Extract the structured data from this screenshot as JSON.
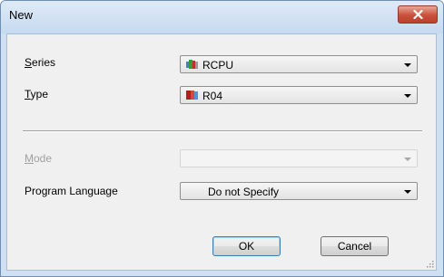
{
  "window": {
    "title": "New"
  },
  "form": {
    "series": {
      "label": "Series",
      "accel": "S",
      "rest": "eries",
      "value": "RCPU",
      "icon": "rcpu-series-icon"
    },
    "type": {
      "label": "Type",
      "accel": "T",
      "rest": "ype",
      "value": "R04",
      "icon": "r04-cpu-icon"
    },
    "mode": {
      "label": "Mode",
      "accel": "M",
      "rest": "ode",
      "value": "",
      "enabled": false
    },
    "language": {
      "label": "Program Language",
      "pre": "Pro",
      "accel": "g",
      "rest": "ram Language",
      "value": "Do not Specify"
    }
  },
  "buttons": {
    "ok": "OK",
    "cancel": "Cancel"
  },
  "colors": {
    "close_button": "#c9503a",
    "title_bar": "#cfe0f2",
    "client": "#f0f0f0"
  }
}
